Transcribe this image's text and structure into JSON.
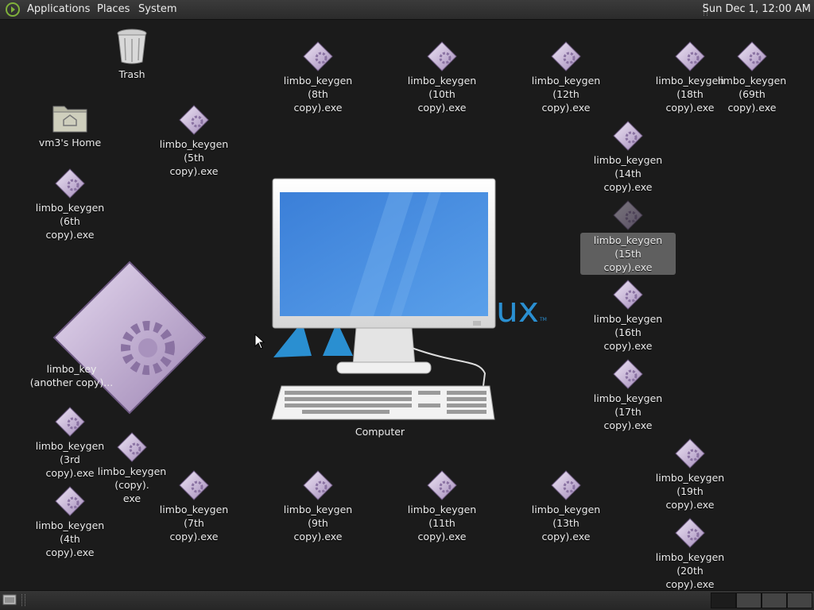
{
  "top_panel": {
    "menus": [
      "Applications",
      "Places",
      "System"
    ],
    "clock": "Sun Dec  1, 12:00 AM"
  },
  "desktop": {
    "trash": "Trash",
    "home": "vm3's Home",
    "computer": "Computer",
    "wallpaper_text": "ux",
    "big_icon_label": "limbo_key\n(another copy)...",
    "icons": [
      {
        "label": "limbo_keygen (5th\ncopy).exe"
      },
      {
        "label": "limbo_keygen (6th\ncopy).exe"
      },
      {
        "label": "limbo_keygen (8th\ncopy).exe"
      },
      {
        "label": "limbo_keygen (10th\ncopy).exe"
      },
      {
        "label": "limbo_keygen (12th\ncopy).exe"
      },
      {
        "label": "limbo_keygen (18th\ncopy).exe"
      },
      {
        "label": "limbo_keygen (69th\ncopy).exe"
      },
      {
        "label": "limbo_keygen (14th\ncopy).exe"
      },
      {
        "label": "limbo_keygen (15th\ncopy).exe"
      },
      {
        "label": "limbo_keygen (16th\ncopy).exe"
      },
      {
        "label": "limbo_keygen (17th\ncopy).exe"
      },
      {
        "label": "limbo_keygen (3rd\ncopy).exe"
      },
      {
        "label": "limbo_keygen (copy).\nexe"
      },
      {
        "label": "limbo_keygen (4th\ncopy).exe"
      },
      {
        "label": "limbo_keygen (7th\ncopy).exe"
      },
      {
        "label": "limbo_keygen (9th\ncopy).exe"
      },
      {
        "label": "limbo_keygen (11th\ncopy).exe"
      },
      {
        "label": "limbo_keygen (13th\ncopy).exe"
      },
      {
        "label": "limbo_keygen (19th\ncopy).exe"
      },
      {
        "label": "limbo_keygen (20th\ncopy).exe"
      }
    ]
  },
  "colors": {
    "panel": "#2e2e2e",
    "desktop": "#1b1b1b",
    "icon_diamond": "#c8b6d6",
    "accent_blue": "#2a8fd1"
  }
}
